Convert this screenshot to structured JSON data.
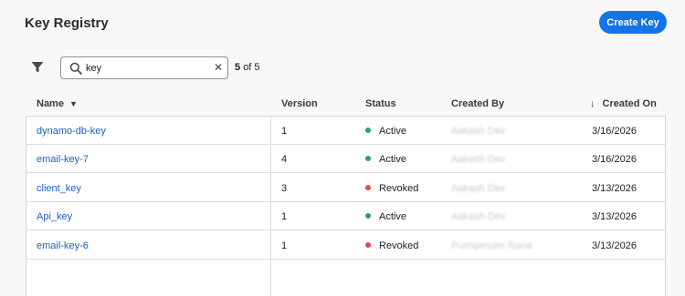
{
  "header": {
    "title": "Key Registry",
    "create_label": "Create Key"
  },
  "search": {
    "value": "key",
    "placeholder": "Search",
    "count_shown": "5",
    "count_total": "of 5"
  },
  "columns": {
    "name": "Name",
    "version": "Version",
    "status": "Status",
    "created_by": "Created By",
    "created_on": "Created On"
  },
  "rows": [
    {
      "name": "dynamo-db-key",
      "version": "1",
      "status": "Active",
      "status_color": "#2d9d78",
      "created_by": "Aakash Dev",
      "created_on": "3/16/2026"
    },
    {
      "name": "email-key-7",
      "version": "4",
      "status": "Active",
      "status_color": "#2d9d78",
      "created_by": "Aakash Dev",
      "created_on": "3/16/2026"
    },
    {
      "name": "client_key",
      "version": "3",
      "status": "Revoked",
      "status_color": "#e34850",
      "created_by": "Aakash Dev",
      "created_on": "3/13/2026"
    },
    {
      "name": "Api_key",
      "version": "1",
      "status": "Active",
      "status_color": "#2d9d78",
      "created_by": "Aakash Dev",
      "created_on": "3/13/2026"
    },
    {
      "name": "email-key-6",
      "version": "1",
      "status": "Revoked",
      "status_color": "#e34850",
      "created_by": "Pushpender Rana",
      "created_on": "3/13/2026"
    }
  ],
  "icons": {
    "filter": "filter-icon",
    "search": "search-icon",
    "clear": "close-icon",
    "sort_name": "chevron-down-icon",
    "sort_date": "arrow-down-icon"
  },
  "colors": {
    "accent": "#1473e6",
    "link": "#1c5fc4",
    "active": "#2d9d78",
    "revoked": "#e34850"
  }
}
